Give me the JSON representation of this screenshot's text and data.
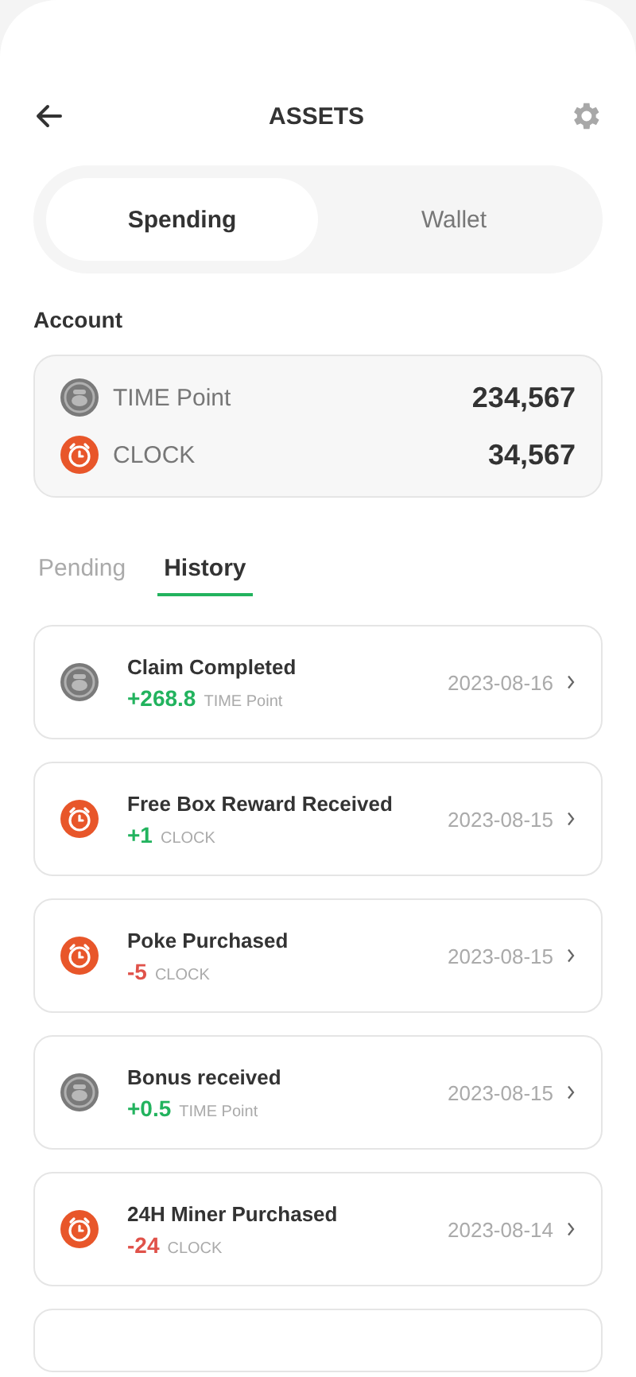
{
  "header": {
    "title": "ASSETS"
  },
  "tabs": [
    {
      "label": "Spending",
      "selected": true
    },
    {
      "label": "Wallet",
      "selected": false
    }
  ],
  "account": {
    "title": "Account",
    "balances": [
      {
        "kind": "point",
        "name": "TIME Point",
        "amount": "234,567"
      },
      {
        "kind": "clock",
        "name": "CLOCK",
        "amount": "34,567"
      }
    ]
  },
  "subtabs": [
    {
      "label": "Pending",
      "selected": false
    },
    {
      "label": "History",
      "selected": true
    }
  ],
  "transactions": [
    {
      "kind": "point",
      "title": "Claim Completed",
      "amount": "+268.8",
      "gain": true,
      "unit": "TIME Point",
      "date": "2023-08-16"
    },
    {
      "kind": "clock",
      "title": "Free Box Reward Received",
      "amount": "+1",
      "gain": true,
      "unit": "CLOCK",
      "date": "2023-08-15"
    },
    {
      "kind": "clock",
      "title": "Poke Purchased",
      "amount": "-5",
      "gain": false,
      "unit": "CLOCK",
      "date": "2023-08-15"
    },
    {
      "kind": "point",
      "title": "Bonus received",
      "amount": "+0.5",
      "gain": true,
      "unit": "TIME Point",
      "date": "2023-08-15"
    },
    {
      "kind": "clock",
      "title": "24H Miner Purchased",
      "amount": "-24",
      "gain": false,
      "unit": "CLOCK",
      "date": "2023-08-14"
    }
  ]
}
